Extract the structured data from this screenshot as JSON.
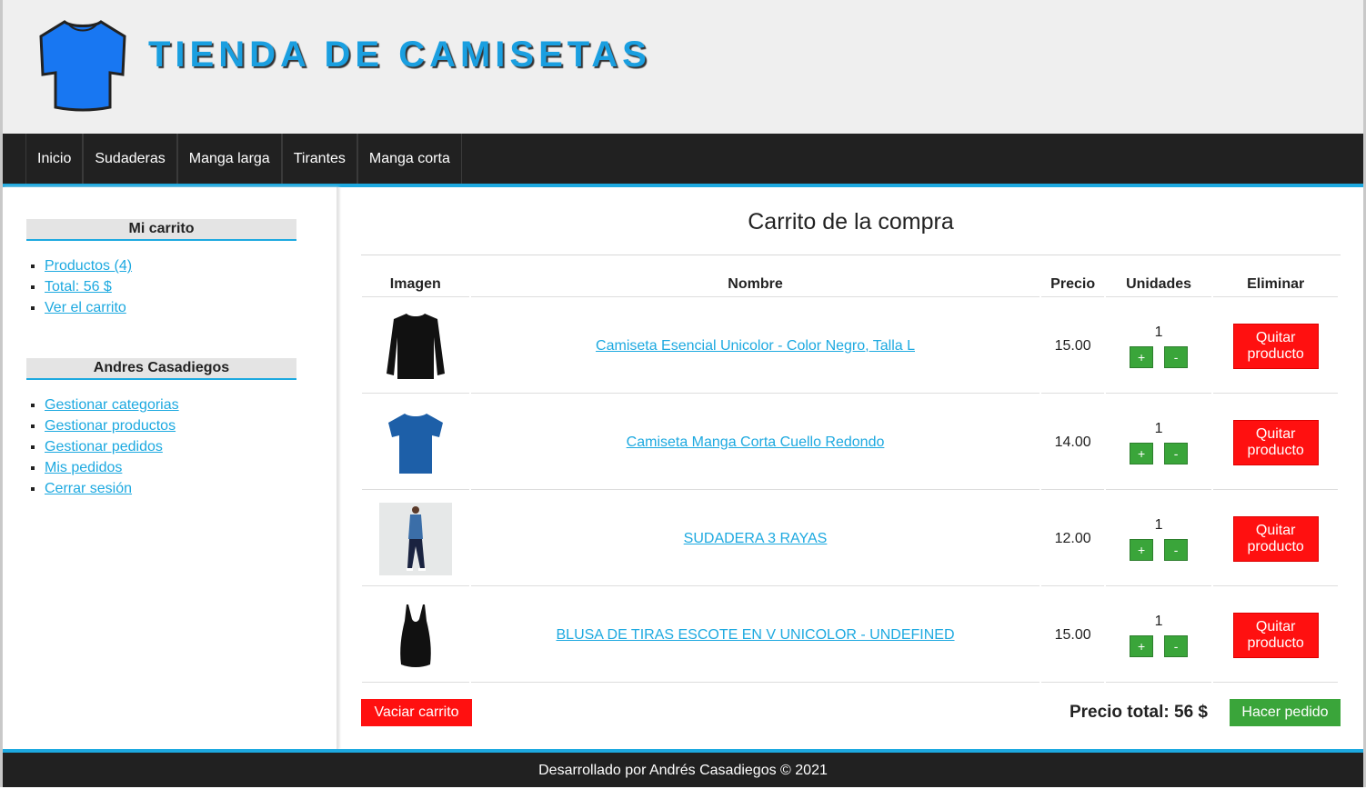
{
  "header": {
    "title": "TIENDA DE CAMISETAS",
    "logo_icon": "tshirt-icon",
    "accent": "#1a9fe0"
  },
  "nav": {
    "items": [
      "Inicio",
      "Sudaderas",
      "Manga larga",
      "Tirantes",
      "Manga corta"
    ]
  },
  "sidebar": {
    "cart": {
      "title": "Mi carrito",
      "links": [
        "Productos (4)",
        "Total: 56 $",
        "Ver el carrito"
      ]
    },
    "user": {
      "title": "Andres Casadiegos",
      "links": [
        "Gestionar categorias",
        "Gestionar productos",
        "Gestionar pedidos",
        "Mis pedidos",
        "Cerrar sesión"
      ]
    }
  },
  "main": {
    "title": "Carrito de la compra",
    "columns": [
      "Imagen",
      "Nombre",
      "Precio",
      "Unidades",
      "Eliminar"
    ],
    "rows": [
      {
        "image": "black-longsleeve-shirt-image",
        "name": "Camiseta Esencial Unicolor - Color Negro, Talla L",
        "price": "15.00",
        "units": "1",
        "plus": "+",
        "minus": "-",
        "remove": "Quitar producto"
      },
      {
        "image": "blue-tshirt-image",
        "name": "Camiseta Manga Corta Cuello Redondo",
        "price": "14.00",
        "units": "1",
        "plus": "+",
        "minus": "-",
        "remove": "Quitar producto"
      },
      {
        "image": "model-tracksuit-image",
        "name": "SUDADERA 3 RAYAS",
        "price": "12.00",
        "units": "1",
        "plus": "+",
        "minus": "-",
        "remove": "Quitar producto"
      },
      {
        "image": "black-tank-top-image",
        "name": "BLUSA DE TIRAS ESCOTE EN V UNICOLOR - UNDEFINED",
        "price": "15.00",
        "units": "1",
        "plus": "+",
        "minus": "-",
        "remove": "Quitar producto"
      }
    ],
    "empty_label": "Vaciar carrito",
    "total_label": "Precio total: 56 $",
    "order_label": "Hacer pedido"
  },
  "footer": {
    "text": "Desarrollado por Andrés Casadiegos © 2021"
  },
  "colors": {
    "red": "#ff1010",
    "green": "#3aa53a",
    "dark": "#212121",
    "link": "#1da9e0"
  }
}
